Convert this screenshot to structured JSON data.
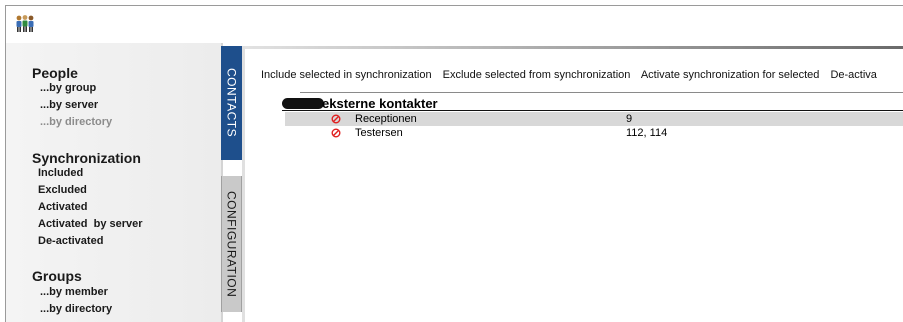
{
  "sidebar": {
    "people": {
      "title": "People",
      "items": [
        {
          "label": "...by group",
          "enabled": true
        },
        {
          "label": "...by server",
          "enabled": true
        },
        {
          "label": "...by directory",
          "enabled": false
        }
      ]
    },
    "synchronization": {
      "title": "Synchronization",
      "items": [
        {
          "label": "Included"
        },
        {
          "label": "Excluded"
        },
        {
          "label": "Activated"
        },
        {
          "label": "Activated  by server"
        },
        {
          "label": "De-activated"
        }
      ]
    },
    "groups": {
      "title": "Groups",
      "items": [
        {
          "label": "...by member"
        },
        {
          "label": "...by directory"
        }
      ]
    }
  },
  "tabs": {
    "contacts": "CONTACTS",
    "configuration": "CONFIGURATION",
    "active": "contacts"
  },
  "toolbar": {
    "include": "Include selected in synchronization",
    "exclude": "Exclude selected from synchronization",
    "activate": "Activate synchronization for selected",
    "deactivate": "De-activa"
  },
  "contact_group": {
    "name": "eksterne kontakter",
    "rows": [
      {
        "name": "Receptionen",
        "extensions": "9",
        "status_icon": "blocked-icon",
        "selected": true
      },
      {
        "name": "Testersen",
        "extensions": "112, 114",
        "status_icon": "blocked-icon",
        "selected": false
      }
    ]
  },
  "colors": {
    "active_tab": "#1e4f8c",
    "inactive_tab": "#c9c9c9",
    "selected_row": "#d8d8d8",
    "blocked_icon": "#e02020"
  }
}
